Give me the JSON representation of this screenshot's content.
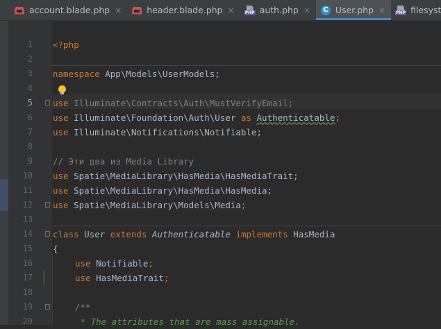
{
  "tabs": [
    {
      "name": "account.blade.php",
      "icon": "blade-file-icon",
      "active": false
    },
    {
      "name": "header.blade.php",
      "icon": "blade-file-icon",
      "active": false
    },
    {
      "name": "auth.php",
      "icon": "php-file-icon",
      "active": false
    },
    {
      "name": "User.php",
      "icon": "class-icon",
      "active": true
    },
    {
      "name": "filesystems.php",
      "icon": "php-file-icon",
      "active": false
    }
  ],
  "tab_close_glyph": "×",
  "php_badge": "PHP",
  "class_badge": "C",
  "line_numbers": [
    "1",
    "2",
    "3",
    "4",
    "5",
    "6",
    "7",
    "8",
    "9",
    "10",
    "11",
    "12",
    "13",
    "14",
    "15",
    "16",
    "17",
    "18",
    "19",
    "20"
  ],
  "current_line": "5",
  "code": {
    "l1": {
      "a": "<?php"
    },
    "l3": {
      "a": "namespace",
      "b": " App\\Models\\UserModels;"
    },
    "l5": {
      "a": "use",
      "b": " Illuminate\\Contracts\\Auth\\MustVerifyEmail;"
    },
    "l6": {
      "a": "use",
      "b": " Illuminate\\Foundation\\Auth\\User ",
      "c": "as",
      "d": " ",
      "e": "Authenticatable",
      "f": ";"
    },
    "l7": {
      "a": "use",
      "b": " Illuminate\\Notifications\\Notifiable;"
    },
    "l9": {
      "a": "// Эти два из Media Library"
    },
    "l10": {
      "a": "use",
      "b": " Spatie\\MediaLibrary\\HasMedia\\HasMediaTrait;"
    },
    "l11": {
      "a": "use",
      "b": " Spatie\\MediaLibrary\\HasMedia\\HasMedia;"
    },
    "l12": {
      "a": "use",
      "b": " Spatie\\MediaLibrary\\Models\\Media",
      "c": ";"
    },
    "l14": {
      "a": "class",
      "b": " User ",
      "c": "extends",
      "d": " ",
      "e": "Authenticatable",
      "f": " ",
      "g": "implements",
      "h": " HasMedia"
    },
    "l15": {
      "a": "{"
    },
    "l16": {
      "a": "use",
      "b": " Notifiable",
      "c": ";"
    },
    "l17": {
      "a": "use",
      "b": " HasMediaTrait",
      "c": ";"
    },
    "l19": {
      "a": "/**"
    },
    "l20": {
      "a": " * The attributes that are mass assignable."
    }
  },
  "colors": {
    "background": "#2b2b2b",
    "keyword": "#cc7832",
    "text": "#a9b7c6",
    "comment": "#808080",
    "doc_comment": "#629755",
    "active_tab_underline": "#4a88c7"
  }
}
